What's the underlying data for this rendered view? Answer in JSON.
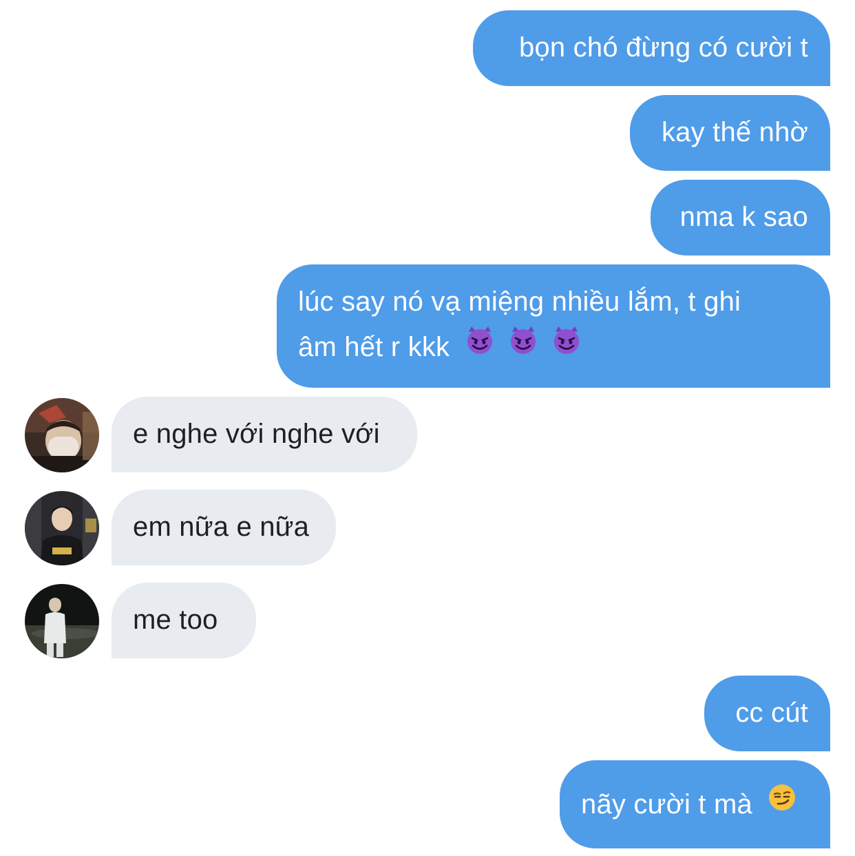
{
  "conversation": {
    "outgoing_1": "bọn chó đừng có cười t",
    "outgoing_2": "kay thế nhờ",
    "outgoing_3": "nma k sao",
    "outgoing_4_line1": "lúc say nó vạ miệng nhiều lắm, t ghi",
    "outgoing_4_line2": "âm hết r kkk",
    "incoming_1": "e nghe với nghe với",
    "incoming_2": "em nữa e nữa",
    "incoming_3": "me too",
    "outgoing_5": "cc cút",
    "outgoing_6": "nãy cười t mà"
  },
  "emojis": {
    "outgoing_4": [
      "smiling-devil-icon",
      "smiling-devil-icon",
      "smiling-devil-icon"
    ],
    "outgoing_6": [
      "smirk-icon"
    ]
  },
  "colors": {
    "outgoing_bubble": "#4f9ce9",
    "incoming_bubble": "#e8ebf0",
    "background": "#ffffff"
  }
}
